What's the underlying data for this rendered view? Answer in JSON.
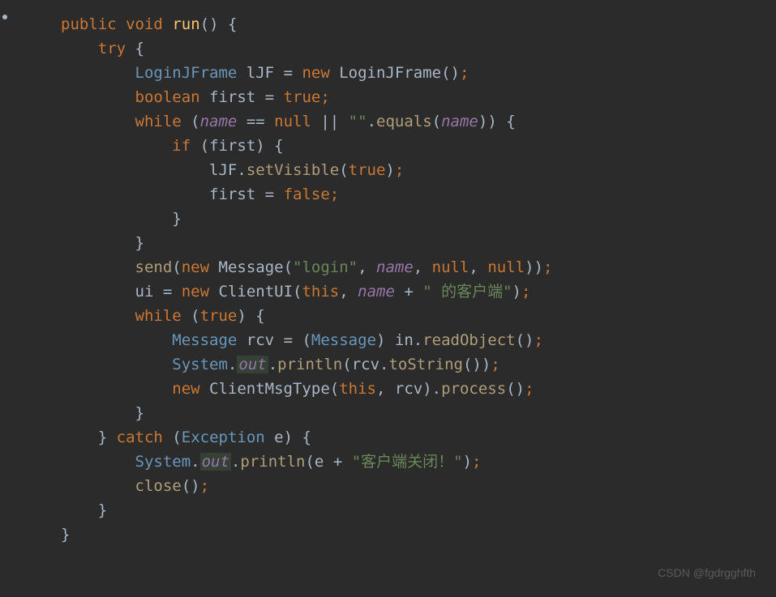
{
  "code": {
    "line1": {
      "public": "public",
      "void": "void",
      "method": "run",
      "parens": "()",
      "brace": " {"
    },
    "line2": {
      "try": "try",
      "brace": " {"
    },
    "line3": {
      "type": "LoginJFrame",
      "var": " lJF ",
      "eq": "=",
      "new": " new ",
      "ctor": "LoginJFrame",
      "parens": "()",
      "semi": ";"
    },
    "line4": {
      "type": "boolean",
      "var": " first ",
      "eq": "=",
      "true": " true",
      "semi": ";"
    },
    "line5": {
      "while": "while",
      "open": " (",
      "name1": "name",
      "eqeq": " == ",
      "null": "null",
      "or": " || ",
      "str": "\"\"",
      "dot": ".",
      "equals": "equals",
      "open2": "(",
      "name2": "name",
      "close2": ")",
      "close": ")",
      "brace": " {"
    },
    "line6": {
      "if": "if",
      "open": " (",
      "var": "first",
      "close": ")",
      "brace": " {"
    },
    "line7": {
      "obj": "lJF",
      "dot": ".",
      "method": "setVisible",
      "open": "(",
      "true": "true",
      "close": ")",
      "semi": ";"
    },
    "line8": {
      "var": "first ",
      "eq": "=",
      "false": " false",
      "semi": ";"
    },
    "line9": {
      "brace": "}"
    },
    "line10": {
      "brace": "}"
    },
    "line11": {
      "method": "send",
      "open": "(",
      "new": "new ",
      "ctor": "Message",
      "open2": "(",
      "str": "\"login\"",
      "comma1": ", ",
      "name": "name",
      "comma2": ", ",
      "null1": "null",
      "comma3": ", ",
      "null2": "null",
      "close2": ")",
      "close": ")",
      "semi": ";"
    },
    "line12": {
      "var": "ui ",
      "eq": "=",
      "new": " new ",
      "ctor": "ClientUI",
      "open": "(",
      "this": "this",
      "comma": ", ",
      "name": "name",
      "plus": " + ",
      "str": "\" 的客户端\"",
      "close": ")",
      "semi": ";"
    },
    "line13": {
      "while": "while",
      "open": " (",
      "true": "true",
      "close": ")",
      "brace": " {"
    },
    "line14": {
      "type": "Message",
      "var": " rcv ",
      "eq": "=",
      "open": " (",
      "cast": "Message",
      "close": ")",
      "obj": " in",
      "dot": ".",
      "method": "readObject",
      "parens": "()",
      "semi": ";"
    },
    "line15": {
      "sys": "System",
      "dot1": ".",
      "out": "out",
      "dot2": ".",
      "method": "println",
      "open": "(",
      "obj": "rcv",
      "dot3": ".",
      "tostr": "toString",
      "parens": "()",
      "close": ")",
      "semi": ";"
    },
    "line16": {
      "new": "new ",
      "ctor": "ClientMsgType",
      "open": "(",
      "this": "this",
      "comma": ", ",
      "var": "rcv",
      "close": ")",
      "dot": ".",
      "method": "process",
      "parens": "()",
      "semi": ";"
    },
    "line17": {
      "brace": "}"
    },
    "line18": {
      "brace1": "}",
      "catch": " catch ",
      "open": "(",
      "type": "Exception",
      "var": " e",
      "close": ")",
      "brace2": " {"
    },
    "line19": {
      "sys": "System",
      "dot1": ".",
      "out": "out",
      "dot2": ".",
      "method": "println",
      "open": "(",
      "var": "e ",
      "plus": "+",
      "str": " \"客户端关闭！\"",
      "close": ")",
      "semi": ";"
    },
    "line20": {
      "method": "close",
      "parens": "()",
      "semi": ";"
    },
    "line21": {
      "brace": "}"
    },
    "line22": {
      "brace": "}"
    }
  },
  "watermark": "CSDN @fgdrgghfth"
}
